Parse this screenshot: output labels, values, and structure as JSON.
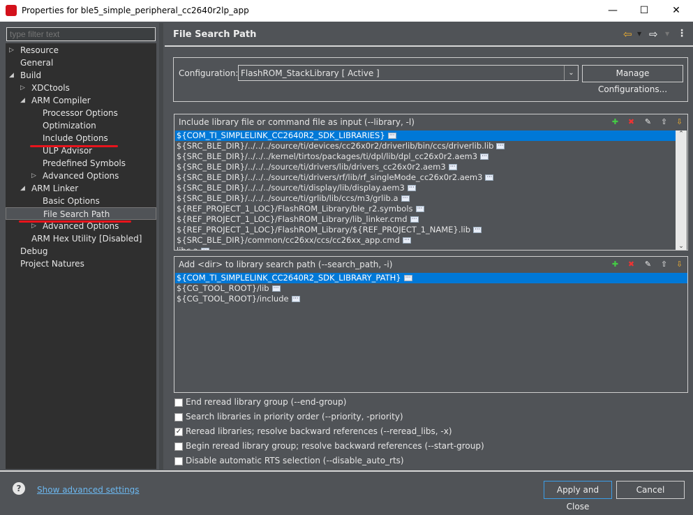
{
  "window": {
    "title": "Properties for ble5_simple_peripheral_cc2640r2lp_app",
    "minimize": "—",
    "maximize": "☐",
    "close": "✕"
  },
  "filter": {
    "placeholder": "type filter text"
  },
  "tree": [
    {
      "label": "Resource",
      "arrow": "▷"
    },
    {
      "label": "General",
      "arrow": ""
    },
    {
      "label": "Build",
      "arrow": "◢"
    },
    {
      "label": "XDCtools",
      "arrow": "▷"
    },
    {
      "label": "ARM Compiler",
      "arrow": "◢"
    },
    {
      "label": "Processor Options",
      "arrow": ""
    },
    {
      "label": "Optimization",
      "arrow": ""
    },
    {
      "label": "Include Options",
      "arrow": ""
    },
    {
      "label": "ULP Advisor",
      "arrow": ""
    },
    {
      "label": "Predefined Symbols",
      "arrow": ""
    },
    {
      "label": "Advanced Options",
      "arrow": "▷"
    },
    {
      "label": "ARM Linker",
      "arrow": "◢"
    },
    {
      "label": "Basic Options",
      "arrow": ""
    },
    {
      "label": "File Search Path",
      "arrow": "",
      "selected": true
    },
    {
      "label": "Advanced Options",
      "arrow": "▷"
    },
    {
      "label": "ARM Hex Utility  [Disabled]",
      "arrow": ""
    },
    {
      "label": "Debug",
      "arrow": ""
    },
    {
      "label": "Project Natures",
      "arrow": ""
    }
  ],
  "page": {
    "title": "File Search Path",
    "back_icon": "arrow-left-icon",
    "forward_icon": "arrow-right-icon"
  },
  "config": {
    "label": "Configuration:",
    "value": "FlashROM_StackLibrary  [ Active ]",
    "manage": "Manage Configurations..."
  },
  "libraries": {
    "title": "Include library file or command file as input (--library, -l)",
    "items": [
      "${COM_TI_SIMPLELINK_CC2640R2_SDK_LIBRARIES}",
      "${SRC_BLE_DIR}/../../../source/ti/devices/cc26x0r2/driverlib/bin/ccs/driverlib.lib",
      "${SRC_BLE_DIR}/../../../kernel/tirtos/packages/ti/dpl/lib/dpl_cc26x0r2.aem3",
      "${SRC_BLE_DIR}/../../../source/ti/drivers/lib/drivers_cc26x0r2.aem3",
      "${SRC_BLE_DIR}/../../../source/ti/drivers/rf/lib/rf_singleMode_cc26x0r2.aem3",
      "${SRC_BLE_DIR}/../../../source/ti/display/lib/display.aem3",
      "${SRC_BLE_DIR}/../../../source/ti/grlib/lib/ccs/m3/grlib.a",
      "${REF_PROJECT_1_LOC}/FlashROM_Library/ble_r2.symbols",
      "${REF_PROJECT_1_LOC}/FlashROM_Library/lib_linker.cmd",
      "${REF_PROJECT_1_LOC}/FlashROM_Library/${REF_PROJECT_1_NAME}.lib",
      "${SRC_BLE_DIR}/common/cc26xx/ccs/cc26xx_app.cmd",
      "libc.a"
    ]
  },
  "search_paths": {
    "title": "Add <dir> to library search path (--search_path, -i)",
    "items": [
      "${COM_TI_SIMPLELINK_CC2640R2_SDK_LIBRARY_PATH}",
      "${CG_TOOL_ROOT}/lib",
      "${CG_TOOL_ROOT}/include"
    ]
  },
  "options": [
    {
      "label": "End reread library group (--end-group)",
      "checked": false
    },
    {
      "label": "Search libraries in priority order (--priority, -priority)",
      "checked": false
    },
    {
      "label": "Reread libraries; resolve backward references (--reread_libs, -x)",
      "checked": true
    },
    {
      "label": "Begin reread library group; resolve backward references (--start-group)",
      "checked": false
    },
    {
      "label": "Disable automatic RTS selection (--disable_auto_rts)",
      "checked": false
    }
  ],
  "footer": {
    "advanced": "Show advanced settings",
    "apply": "Apply and Close",
    "cancel": "Cancel"
  },
  "colors": {
    "accent": "#0078d7",
    "annotation": "#e8141c"
  }
}
